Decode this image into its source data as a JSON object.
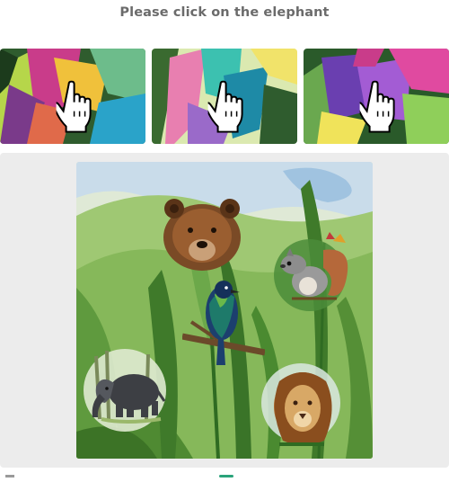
{
  "instruction": "Please click on the elephant",
  "example_tiles": [
    {
      "name": "example-tile-1",
      "hint_icon": "pointer-hand-icon"
    },
    {
      "name": "example-tile-2",
      "hint_icon": "pointer-hand-icon"
    },
    {
      "name": "example-tile-3",
      "hint_icon": "pointer-hand-icon"
    }
  ],
  "scene": {
    "animals": [
      "bear",
      "squirrel",
      "bird",
      "elephant",
      "lion"
    ]
  },
  "colors": {
    "instruction_text": "#6b6b6b",
    "panel_bg": "#ececec",
    "footer_accent": "#2aa37a"
  }
}
